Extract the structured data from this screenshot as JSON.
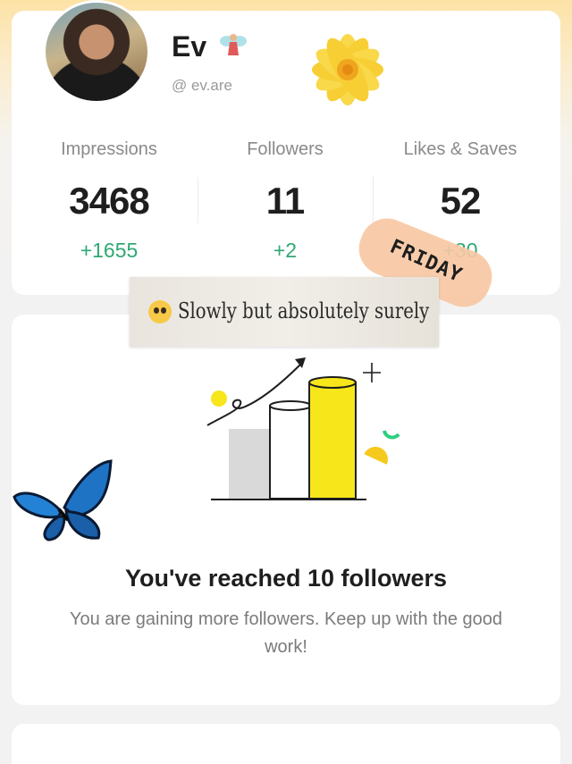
{
  "profile": {
    "name": "Ev",
    "handle": "@ ev.are"
  },
  "stats": [
    {
      "label": "Impressions",
      "value": "3468",
      "delta": "+1655"
    },
    {
      "label": "Followers",
      "value": "11",
      "delta": "+2"
    },
    {
      "label": "Likes & Saves",
      "value": "52",
      "delta": "+30"
    }
  ],
  "stickers": {
    "friday": "FRIDAY",
    "note": "Slowly but absolutely surely"
  },
  "milestone": {
    "title": "You've reached 10 followers",
    "body": "You are gaining more followers. Keep up with the good work!"
  },
  "colors": {
    "accent_green": "#2fa873",
    "highlight_yellow": "#f7e61a",
    "header_gradient": "#fde2a6"
  }
}
